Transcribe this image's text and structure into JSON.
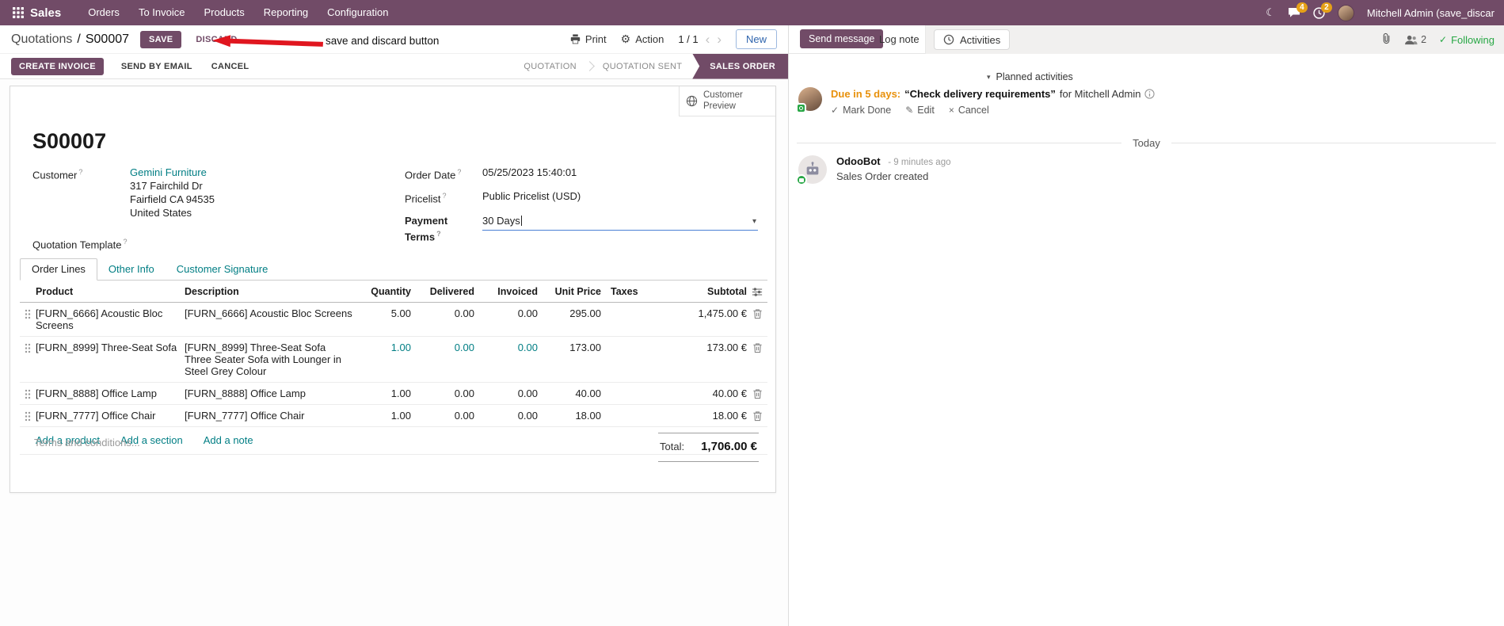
{
  "colors": {
    "brand": "#714B67",
    "link_teal": "#017e84",
    "badge_orange": "#e6a117",
    "annotation_red": "#e0161f",
    "success_green": "#28a745",
    "due_orange": "#e8910c",
    "focus_underline_blue": "#4a7fd4"
  },
  "topbar": {
    "app_name": "Sales",
    "menus": [
      "Orders",
      "To Invoice",
      "Products",
      "Reporting",
      "Configuration"
    ],
    "messages_badge": "4",
    "activities_badge": "2",
    "user_name": "Mitchell Admin (save_discar"
  },
  "control_panel": {
    "breadcrumb_parent": "Quotations",
    "breadcrumb_separator": "/",
    "breadcrumb_current": "S00007",
    "save_label": "SAVE",
    "discard_label": "DISCARD",
    "print_label": "Print",
    "action_label": "Action",
    "pager": "1 / 1",
    "new_label": "New"
  },
  "annotation": {
    "label": "save and discard button"
  },
  "statusbar": {
    "create_invoice": "CREATE INVOICE",
    "send_by_email": "SEND BY EMAIL",
    "cancel": "CANCEL",
    "stages": [
      {
        "label": "QUOTATION"
      },
      {
        "label": "QUOTATION SENT"
      },
      {
        "label": "SALES ORDER"
      }
    ]
  },
  "form": {
    "customer_preview": "Customer Preview",
    "title": "S00007",
    "help_mark": "?",
    "customer": {
      "label": "Customer",
      "name": "Gemini Furniture",
      "address": [
        "317 Fairchild Dr",
        "Fairfield CA 94535",
        "United States"
      ]
    },
    "quotation_template_label": "Quotation Template",
    "order_date": {
      "label": "Order Date",
      "value": "05/25/2023 15:40:01"
    },
    "pricelist": {
      "label": "Pricelist",
      "value": "Public Pricelist (USD)"
    },
    "payment_terms": {
      "label": "Payment Terms",
      "value": "30 Days"
    },
    "tabs": [
      "Order Lines",
      "Other Info",
      "Customer Signature"
    ],
    "order_lines": {
      "headers": [
        "Product",
        "Description",
        "Quantity",
        "Delivered",
        "Invoiced",
        "Unit Price",
        "Taxes",
        "Subtotal"
      ],
      "rows": [
        {
          "product": "[FURN_6666] Acoustic Bloc Screens",
          "description": "[FURN_6666] Acoustic Bloc Screens",
          "description2": "",
          "quantity": "5.00",
          "delivered": "0.00",
          "invoiced": "0.00",
          "unit_price": "295.00",
          "taxes": "",
          "subtotal": "1,475.00 €"
        },
        {
          "product": "[FURN_8999] Three-Seat Sofa",
          "description": "[FURN_8999] Three-Seat Sofa",
          "description2": "Three Seater Sofa with Lounger in Steel Grey Colour",
          "quantity": "1.00",
          "delivered": "0.00",
          "invoiced": "0.00",
          "unit_price": "173.00",
          "taxes": "",
          "subtotal": "173.00 €"
        },
        {
          "product": "[FURN_8888] Office Lamp",
          "description": "[FURN_8888] Office Lamp",
          "description2": "",
          "quantity": "1.00",
          "delivered": "0.00",
          "invoiced": "0.00",
          "unit_price": "40.00",
          "taxes": "",
          "subtotal": "40.00 €"
        },
        {
          "product": "[FURN_7777] Office Chair",
          "description": "[FURN_7777] Office Chair",
          "description2": "",
          "quantity": "1.00",
          "delivered": "0.00",
          "invoiced": "0.00",
          "unit_price": "18.00",
          "taxes": "",
          "subtotal": "18.00 €"
        }
      ],
      "add_product": "Add a product",
      "add_section": "Add a section",
      "add_note": "Add a note"
    },
    "terms_placeholder": "Terms and conditions...",
    "total_label": "Total:",
    "total_value": "1,706.00 €"
  },
  "chatter": {
    "send_message": "Send message",
    "log_note": "Log note",
    "activities_tab": "Activities",
    "followers_count": "2",
    "following": "Following",
    "following_check": "✓",
    "planned": {
      "section_title": "Planned activities",
      "due": "Due in 5 days:",
      "summary": "“Check delivery requirements”",
      "assignee": "for Mitchell Admin",
      "mark_done": "Mark Done",
      "edit": "Edit",
      "cancel": "Cancel"
    },
    "today": "Today",
    "message": {
      "author": "OdooBot",
      "time": "- 9 minutes ago",
      "body": "Sales Order created"
    }
  }
}
